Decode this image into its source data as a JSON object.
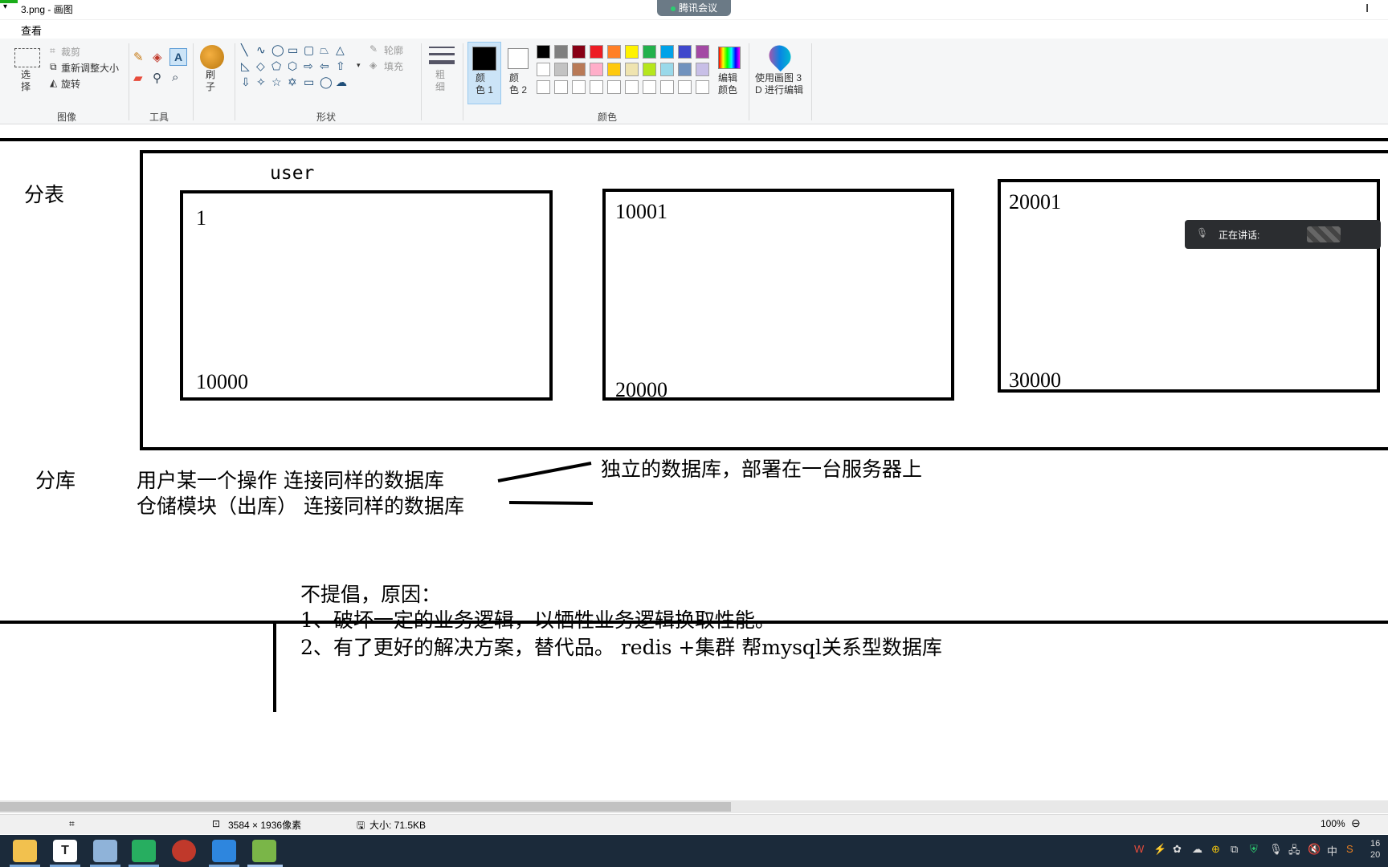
{
  "window": {
    "title": "3.png - 画图",
    "meeting_label": "腾讯会议"
  },
  "tabs": {
    "view": "查看"
  },
  "ribbon": {
    "image_group": {
      "label": "图像",
      "select": "选\n择",
      "crop": "裁剪",
      "resize": "重新调整大小",
      "rotate": "旋转"
    },
    "tools_group": {
      "label": "工具"
    },
    "brush": {
      "label": "刷\n子"
    },
    "shapes_group": {
      "label": "形状",
      "outline": "轮廓",
      "fill": "填充"
    },
    "size": {
      "label": "粗\n细"
    },
    "colors_group": {
      "label": "颜色",
      "color1": "颜\n色 1",
      "color2": "颜\n色 2",
      "edit_colors": "编辑\n颜色"
    },
    "paint3d": {
      "label": "使用画图 3\nD 进行编辑"
    },
    "palette": [
      "#000000",
      "#7f7f7f",
      "#880015",
      "#ed1c24",
      "#ff7f27",
      "#fff200",
      "#22b14c",
      "#00a2e8",
      "#3f48cc",
      "#a349a4",
      "#ffffff",
      "#c3c3c3",
      "#b97a57",
      "#ffaec9",
      "#ffc90e",
      "#efe4b0",
      "#b5e61d",
      "#99d9ea",
      "#7092be",
      "#c8bfe7"
    ]
  },
  "canvas": {
    "fenbiao": "分表",
    "user": "user",
    "box1_top": "1",
    "box1_bottom": "10000",
    "box2_top": "10001",
    "box2_bottom": "20000",
    "box3_top": "20001",
    "box3_bottom": "30000",
    "fenku": "分库",
    "line1": "用户某一个操作   连接同样的数据库",
    "line2": "仓储模块（出库）  连接同样的数据库",
    "independent": "独立的数据库，部署在一台服务器上",
    "reason_title": "不提倡，原因：",
    "reason1": "1、破坏一定的业务逻辑，以牺牲业务逻辑换取性能。",
    "reason2": "2、有了更好的解决方案，替代品。 redis +集群     帮mysql关系型数据库"
  },
  "speaking": {
    "label": "正在讲话:"
  },
  "statusbar": {
    "dimensions": "3584 × 1936像素",
    "size": "大小: 71.5KB",
    "zoom": "100%"
  },
  "tray": {
    "ime": "中",
    "clock": "16\n20"
  }
}
